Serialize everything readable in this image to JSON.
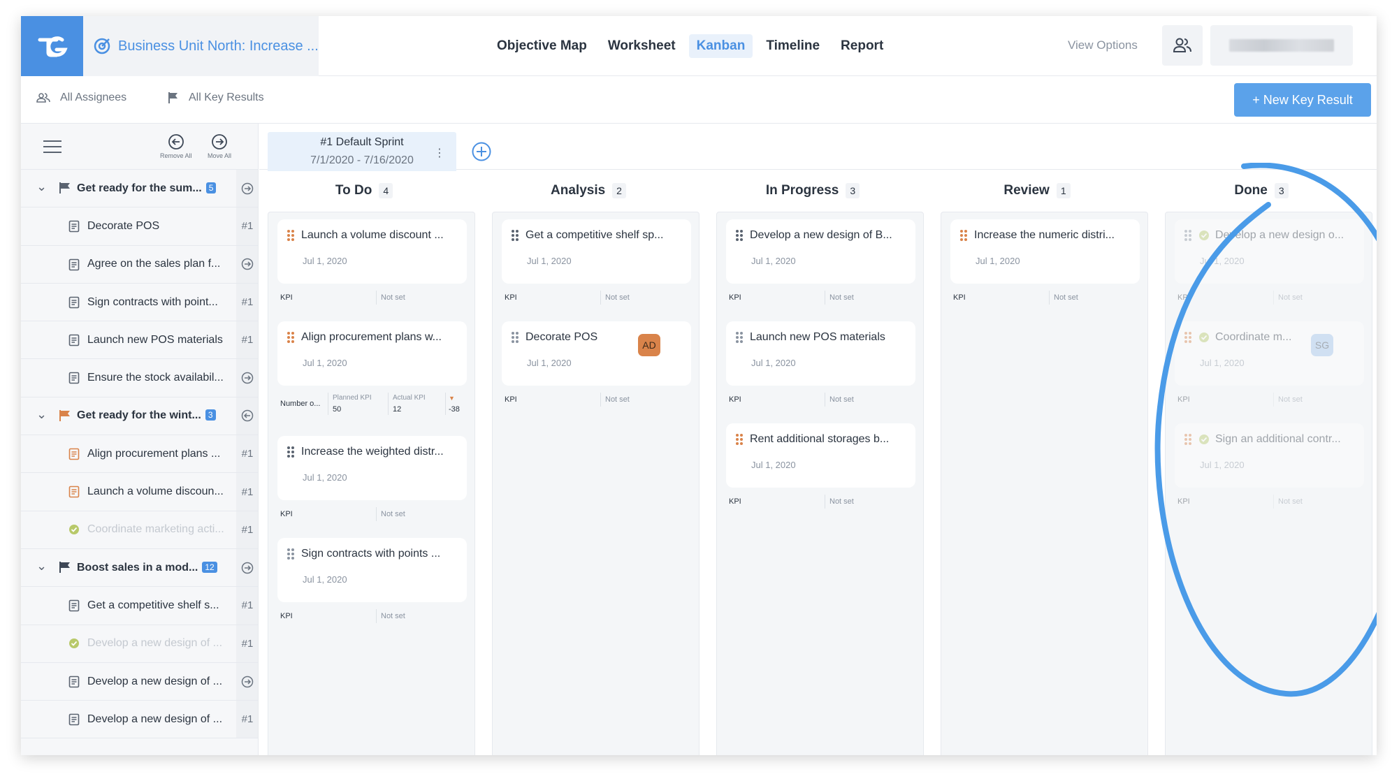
{
  "header": {
    "project_title": "Business Unit North: Increase ...",
    "tabs": [
      {
        "label": "Objective Map",
        "active": false
      },
      {
        "label": "Worksheet",
        "active": false
      },
      {
        "label": "Kanban",
        "active": true
      },
      {
        "label": "Timeline",
        "active": false
      },
      {
        "label": "Report",
        "active": false
      }
    ],
    "view_options": "View Options"
  },
  "filters": {
    "assignees": "All Assignees",
    "key_results": "All Key Results",
    "new_button": "+ New Key Result"
  },
  "sidebar": {
    "remove_all": "Remove All",
    "move_all": "Move All",
    "rows": [
      {
        "type": "group",
        "label": "Get ready for the sum...",
        "count": "5",
        "flag_color": "#5a6370",
        "action": "→"
      },
      {
        "type": "kr",
        "label": "Decorate POS",
        "action": "#1",
        "icon_color": "#5a6370"
      },
      {
        "type": "kr",
        "label": "Agree on the sales plan f...",
        "action": "→",
        "icon_color": "#5a6370"
      },
      {
        "type": "kr",
        "label": "Sign contracts with point...",
        "action": "#1",
        "icon_color": "#5a6370"
      },
      {
        "type": "kr",
        "label": "Launch new POS materials",
        "action": "#1",
        "icon_color": "#5a6370"
      },
      {
        "type": "kr",
        "label": "Ensure the stock availabil...",
        "action": "→",
        "icon_color": "#5a6370"
      },
      {
        "type": "group",
        "label": "Get ready for the wint...",
        "count": "3",
        "flag_color": "#d9834a",
        "action": "←"
      },
      {
        "type": "kr",
        "label": "Align procurement plans ...",
        "action": "#1",
        "icon_color": "#d9834a"
      },
      {
        "type": "kr",
        "label": "Launch a volume discoun...",
        "action": "#1",
        "icon_color": "#d9834a"
      },
      {
        "type": "done",
        "label": "Coordinate marketing acti...",
        "action": "#1"
      },
      {
        "type": "group",
        "label": "Boost sales in a mod...",
        "count": "12",
        "flag_color": "#3d4756",
        "action": "→"
      },
      {
        "type": "kr",
        "label": "Get a competitive shelf s...",
        "action": "#1",
        "icon_color": "#5a6370"
      },
      {
        "type": "done",
        "label": "Develop a new design of ...",
        "action": "#1"
      },
      {
        "type": "kr",
        "label": "Develop a new design of ...",
        "action": "→",
        "icon_color": "#5a6370"
      },
      {
        "type": "kr",
        "label": "Develop a new design of ...",
        "action": "#1",
        "icon_color": "#5a6370"
      }
    ]
  },
  "sprint": {
    "name": "#1 Default Sprint",
    "dates": "7/1/2020 - 7/16/2020"
  },
  "columns": [
    {
      "title": "To Do",
      "count": "4",
      "cards": [
        {
          "title": "Launch a volume discount ...",
          "date": "Jul 1, 2020",
          "grip": "#d9834a",
          "kpi": "KPI",
          "value": "Not set"
        },
        {
          "title": "Align procurement plans w...",
          "date": "Jul 1, 2020",
          "grip": "#d9834a",
          "kpi_detail": {
            "name": "Number o...",
            "planned_label": "Planned KPI",
            "planned": "50",
            "actual_label": "Actual KPI",
            "actual": "12",
            "delta": "-38"
          }
        },
        {
          "title": "Increase the weighted distr...",
          "date": "Jul 1, 2020",
          "grip": "#5a6370",
          "kpi": "KPI",
          "value": "Not set"
        },
        {
          "title": "Sign contracts with points ...",
          "date": "Jul 1, 2020",
          "grip": "#8a93a0",
          "kpi": "KPI",
          "value": "Not set"
        }
      ]
    },
    {
      "title": "Analysis",
      "count": "2",
      "cards": [
        {
          "title": "Get a competitive shelf sp...",
          "date": "Jul 1, 2020",
          "grip": "#5a6370",
          "kpi": "KPI",
          "value": "Not set"
        },
        {
          "title": "Decorate POS",
          "date": "Jul 1, 2020",
          "grip": "#8a93a0",
          "kpi": "KPI",
          "value": "Not set",
          "avatar": "AD"
        }
      ]
    },
    {
      "title": "In Progress",
      "count": "3",
      "cards": [
        {
          "title": "Develop a new design of B...",
          "date": "Jul 1, 2020",
          "grip": "#5a6370",
          "kpi": "KPI",
          "value": "Not set"
        },
        {
          "title": "Launch new POS materials",
          "date": "Jul 1, 2020",
          "grip": "#8a93a0",
          "kpi": "KPI",
          "value": "Not set"
        },
        {
          "title": "Rent additional storages b...",
          "date": "Jul 1, 2020",
          "grip": "#d9834a",
          "kpi": "KPI",
          "value": "Not set"
        }
      ]
    },
    {
      "title": "Review",
      "count": "1",
      "cards": [
        {
          "title": "Increase the numeric distri...",
          "date": "Jul 1, 2020",
          "grip": "#d9834a",
          "kpi": "KPI",
          "value": "Not set"
        }
      ]
    },
    {
      "title": "Done",
      "count": "3",
      "cards": [
        {
          "title": "Develop a new design o...",
          "date": "Jul 1, 2020",
          "grip": "#8a93a0",
          "kpi": "KPI",
          "value": "Not set",
          "done": true
        },
        {
          "title": "Coordinate m...",
          "date": "Jul 1, 2020",
          "grip": "#d9834a",
          "kpi": "KPI",
          "value": "Not set",
          "done": true,
          "avatar": "SG"
        },
        {
          "title": "Sign an additional contr...",
          "date": "Jul 1, 2020",
          "grip": "#d9834a",
          "kpi": "KPI",
          "value": "Not set",
          "done": true
        }
      ]
    }
  ],
  "colors": {
    "accent": "#4a90e2",
    "annotation": "#4a9be8",
    "done_check": "#b8c96a"
  }
}
